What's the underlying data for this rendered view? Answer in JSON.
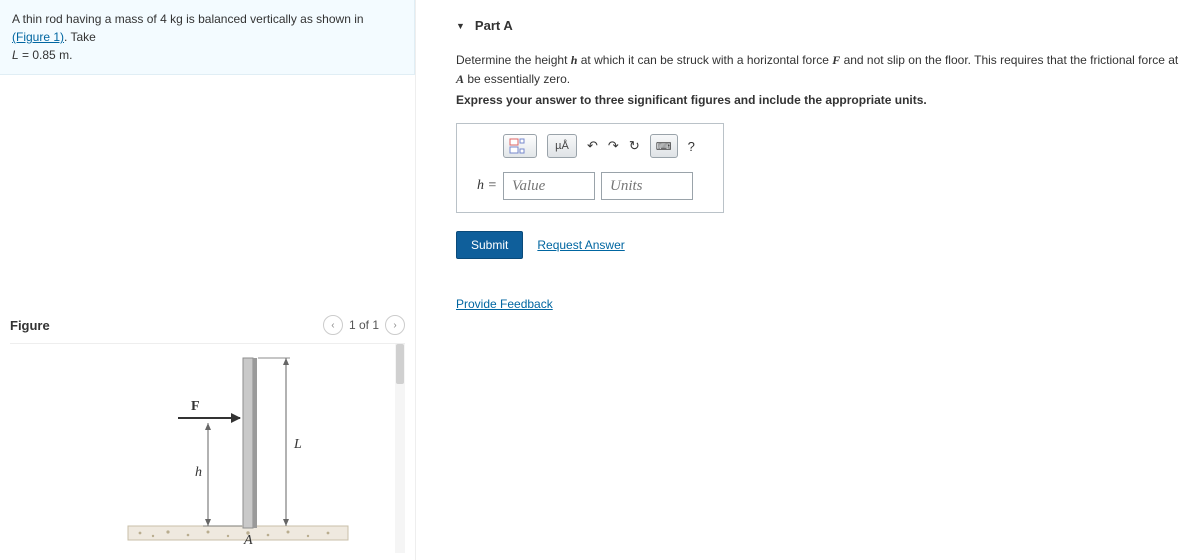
{
  "problem": {
    "prefix": "A thin rod having a mass of 4 ",
    "unit1": "kg",
    "middle": " is balanced vertically as shown in ",
    "figlink": "(Figure 1)",
    "suffix": ". Take",
    "line2_var": "L",
    "line2_eq": " = 0.85 ",
    "line2_unit": "m",
    "line2_end": "."
  },
  "figure": {
    "title": "Figure",
    "nav_prev": "‹",
    "nav_text": "1 of 1",
    "nav_next": "›",
    "labels": {
      "F": "F",
      "L": "L",
      "h": "h",
      "A": "A"
    }
  },
  "part": {
    "caret": "▼",
    "title": "Part A",
    "instr_1": "Determine the height ",
    "instr_h": "h",
    "instr_2": " at which it can be struck with a horizontal force ",
    "instr_F": "F",
    "instr_3": " and not slip on the floor. This requires that the frictional force at ",
    "instr_A": "A",
    "instr_4": " be essentially zero.",
    "hint": "Express your answer to three significant figures and include the appropriate units.",
    "tools": {
      "mu": "µÅ",
      "undo": "↶",
      "redo": "↷",
      "reset": "↻",
      "kbd": "⌨",
      "help": "?"
    },
    "var_label": "h = ",
    "value_ph": "Value",
    "units_ph": "Units",
    "submit": "Submit",
    "request": "Request Answer"
  },
  "feedback_link": "Provide Feedback"
}
